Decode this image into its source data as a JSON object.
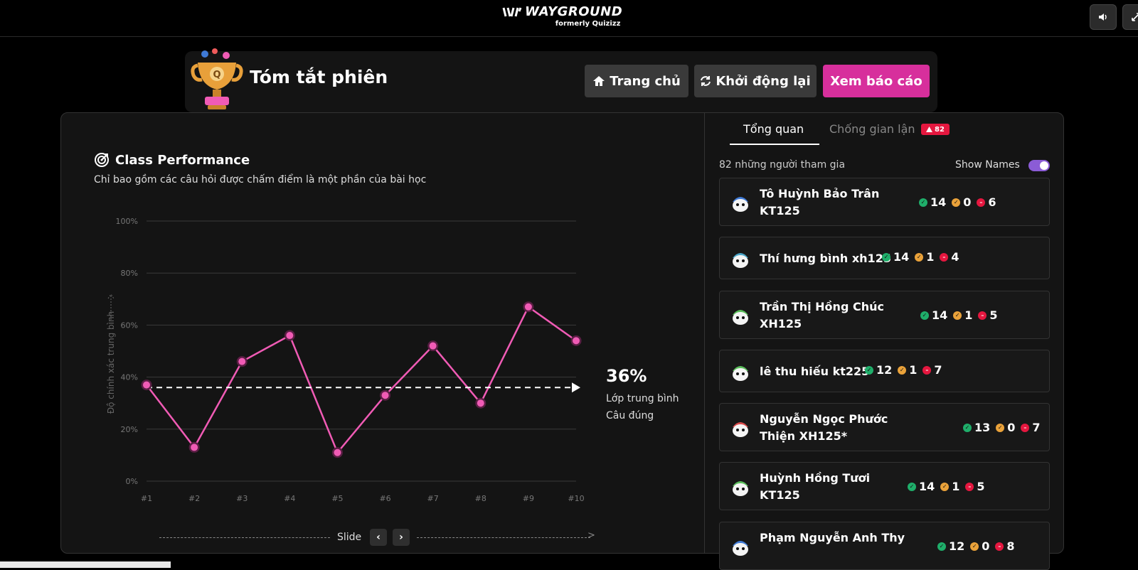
{
  "app": {
    "logo_text": "WAYGROUND",
    "logo_subtitle": "formerly Quizizz",
    "icons": [
      "volume-icon",
      "fullscreen-icon"
    ]
  },
  "session": {
    "title": "Tóm tắt phiên",
    "buttons": {
      "home": "Trang chủ",
      "restart": "Khởi động lại",
      "report": "Xem báo cáo"
    },
    "colors": {
      "report": "#d72f9c",
      "accent": "#f05bb5"
    }
  },
  "performance": {
    "title": "Class Performance",
    "subtitle": "Chỉ bao gồm các câu hỏi được chấm điểm là một phần của bài học",
    "average_value": "36%",
    "average_label_1": "Lớp trung bình",
    "average_label_2": "Câu đúng",
    "slide_label": "Slide"
  },
  "chart_data": {
    "type": "line",
    "ylabel": "Độ chính xác trung bình",
    "xlabel": "Slide",
    "categories": [
      "#1",
      "#2",
      "#3",
      "#4",
      "#5",
      "#6",
      "#7",
      "#8",
      "#9",
      "#10"
    ],
    "values": [
      37,
      13,
      46,
      56,
      11,
      33,
      52,
      30,
      67,
      54
    ],
    "yticks": [
      "100%",
      "80%",
      "60%",
      "40%",
      "20%",
      "0%"
    ],
    "ylim": [
      0,
      100
    ],
    "average_line": 36,
    "grid": true
  },
  "tabs": {
    "overview": "Tổng quan",
    "anticheat": "Chống gian lận",
    "anticheat_badge": "82"
  },
  "participants": {
    "count_label": "82 những người tham gia",
    "show_names_label": "Show Names",
    "show_names_on": true,
    "list": [
      {
        "name": "Tô Huỳnh Bảo Trân KT125",
        "correct": "14",
        "partial": "0",
        "wrong": "6",
        "avatar_color": "#3f7ad6"
      },
      {
        "name": "Thí hưng bình xh125",
        "correct": "14",
        "partial": "1",
        "wrong": "4",
        "avatar_color": "#4aa6c9"
      },
      {
        "name": "Trần Thị Hồng Chúc XH125",
        "correct": "14",
        "partial": "1",
        "wrong": "5",
        "avatar_color": "#5bbf5b"
      },
      {
        "name": "lê thu hiếu kt225",
        "correct": "12",
        "partial": "1",
        "wrong": "7",
        "avatar_color": "#5bbf5b"
      },
      {
        "name": "Nguyễn Ngọc Phước Thiện XH125*",
        "correct": "13",
        "partial": "0",
        "wrong": "7",
        "avatar_color": "#d94a4a"
      },
      {
        "name": "Huỳnh Hồng Tươi KT125",
        "correct": "14",
        "partial": "1",
        "wrong": "5",
        "avatar_color": "#5bbf5b"
      },
      {
        "name": "Phạm Nguyễn Anh Thy",
        "correct": "12",
        "partial": "0",
        "wrong": "8",
        "avatar_color": "#3f7ad6"
      }
    ]
  }
}
